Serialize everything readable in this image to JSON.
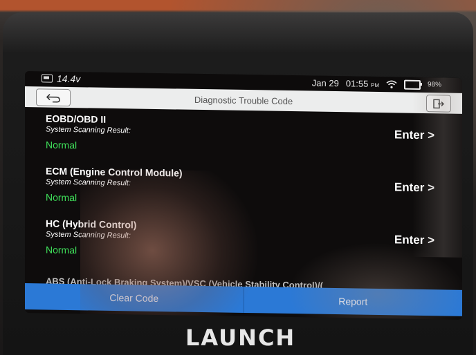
{
  "status": {
    "voltage": "14.4v",
    "date": "Jan 29",
    "time": "01:55",
    "time_suffix": "PM",
    "battery": "98%"
  },
  "header": {
    "title": "Diagnostic Trouble Code"
  },
  "systems": [
    {
      "name": "EOBD/OBD II",
      "result_label": "System Scanning Result:",
      "status": "Normal",
      "action": "Enter >"
    },
    {
      "name": "ECM (Engine Control Module)",
      "result_label": "System Scanning Result:",
      "status": "Normal",
      "action": "Enter >"
    },
    {
      "name": "HC (Hybrid Control)",
      "result_label": "System Scanning Result:",
      "status": "Normal",
      "action": "Enter >"
    }
  ],
  "partial_item": "ABS (Anti-Lock Braking System)/VSC (Vehicle Stability Control)/(",
  "footer": {
    "clear_code": "Clear Code",
    "report": "Report"
  },
  "brand": "LAUNCH",
  "colors": {
    "status_normal": "#3fe05a",
    "button_blue": "#2b79d6",
    "title_bar": "#eceded"
  },
  "icons": {
    "back": "back-arrow-icon",
    "exit": "exit-icon",
    "wifi": "wifi-icon",
    "battery": "battery-icon"
  }
}
